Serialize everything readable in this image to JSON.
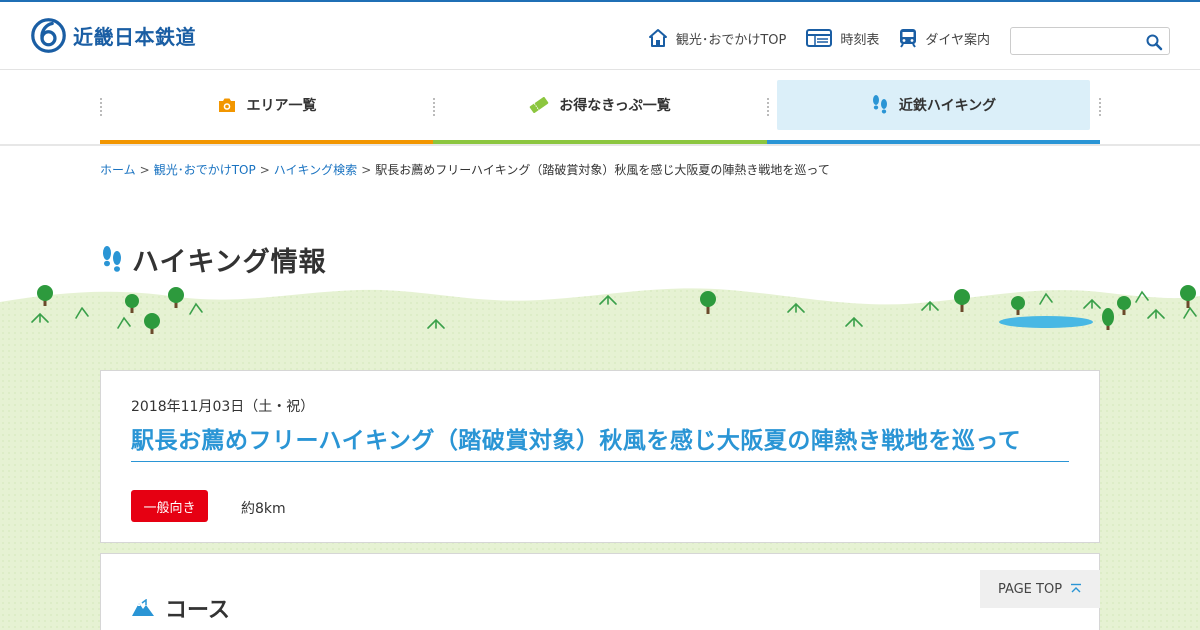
{
  "brand": {
    "name": "近畿日本鉄道"
  },
  "header": {
    "links": [
      {
        "label": "観光･おでかけTOP",
        "icon": "home-icon"
      },
      {
        "label": "時刻表",
        "icon": "timetable-icon"
      },
      {
        "label": "ダイヤ案内",
        "icon": "train-icon"
      }
    ],
    "search": {
      "placeholder": ""
    }
  },
  "gnav": {
    "items": [
      {
        "label": "エリア一覧",
        "icon": "camera-icon",
        "color": "#f29600"
      },
      {
        "label": "お得なきっぷ一覧",
        "icon": "ticket-icon",
        "color": "#8cc63f"
      },
      {
        "label": "近鉄ハイキング",
        "icon": "footprints-icon",
        "color": "#2a95d5"
      }
    ]
  },
  "breadcrumb": {
    "items": [
      "ホーム",
      "観光･おでかけTOP",
      "ハイキング検索"
    ],
    "current": "駅長お薦めフリーハイキング（踏破賞対象）秋風を感じ大阪夏の陣熱き戦地を巡って",
    "separator": ">"
  },
  "page": {
    "title": "ハイキング情報"
  },
  "event": {
    "date": "2018年11月03日（土・祝）",
    "title": "駅長お薦めフリーハイキング（踏破賞対象）秋風を感じ大阪夏の陣熱き戦地を巡って",
    "level": "一般向き",
    "distance": "約8km"
  },
  "course": {
    "title": "コース"
  },
  "pagetop": {
    "label": "PAGE TOP"
  },
  "colors": {
    "brand": "#1a5ea4",
    "accent": "#2a95d5",
    "badge": "#e60012",
    "grass": "#e3f0cf"
  }
}
